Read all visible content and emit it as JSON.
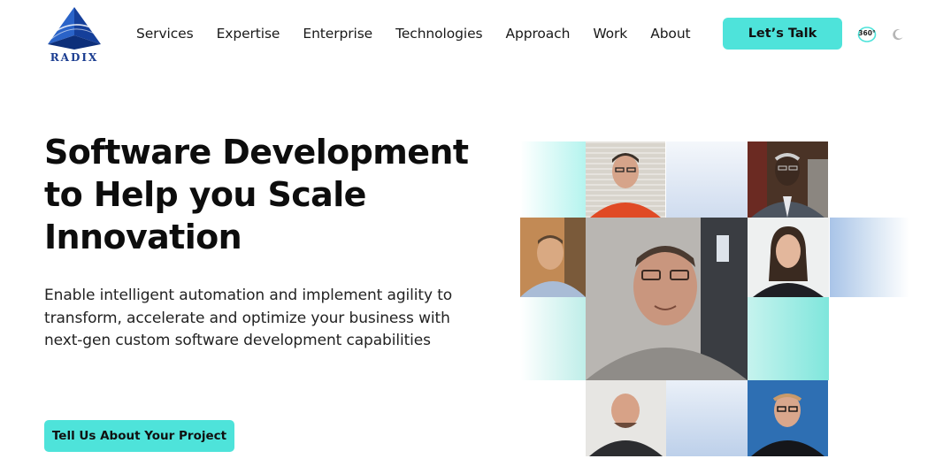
{
  "brand": {
    "logo_text": "RADIX",
    "logo_icon": "pyramid-logo-icon",
    "accent_color": "#4ee3da",
    "logo_color": "#1b3d91"
  },
  "nav": {
    "items": [
      {
        "label": "Services"
      },
      {
        "label": "Expertise"
      },
      {
        "label": "Enterprise"
      },
      {
        "label": "Technologies"
      },
      {
        "label": "Approach"
      },
      {
        "label": "Work"
      },
      {
        "label": "About"
      }
    ],
    "cta_label": "Let’s Talk",
    "badge_label": "360°",
    "theme_toggle_icon": "moon-icon"
  },
  "hero": {
    "title_lines": [
      "Software Development",
      "to Help you Scale",
      "Innovation"
    ],
    "subtitle": "Enable intelligent automation and implement agility to transform, accelerate and optimize your business with next-gen custom software development capabilities",
    "cta_label": "Tell Us About Your Project"
  },
  "video": {
    "play_icon": "play-icon"
  }
}
